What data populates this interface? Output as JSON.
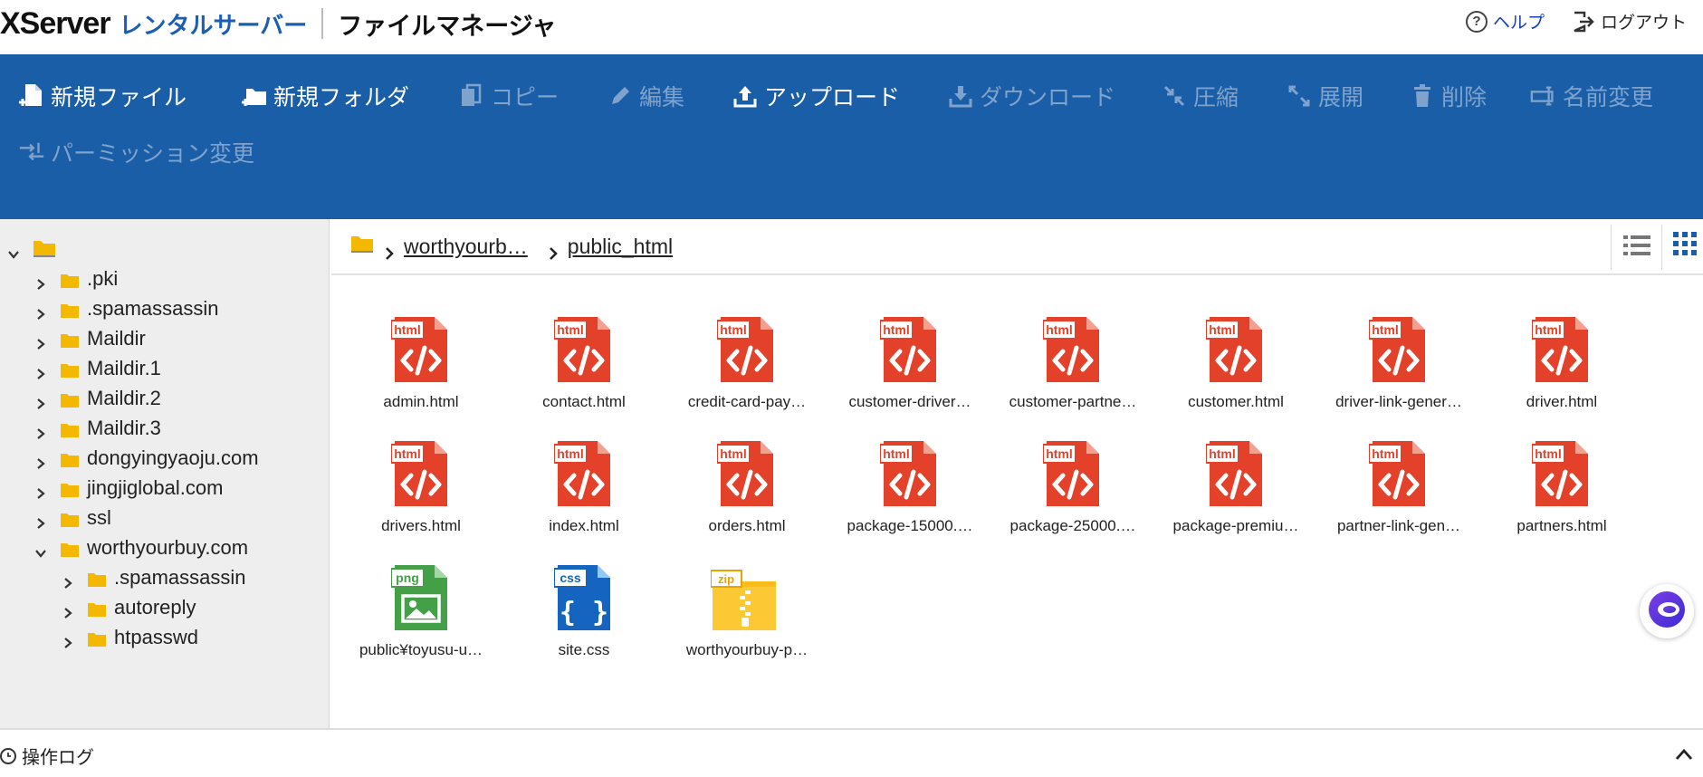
{
  "header": {
    "brand_x": "XServer",
    "brand_rental": "レンタルサーバー",
    "brand_fm": "ファイルマネージャ",
    "help_label": "ヘルプ",
    "help_glyph": "?",
    "logout_label": "ログアウト"
  },
  "toolbar": {
    "new_file": "新規ファイル",
    "new_folder": "新規フォルダ",
    "copy": "コピー",
    "edit": "編集",
    "upload": "アップロード",
    "download": "ダウンロード",
    "compress": "圧縮",
    "extract": "展開",
    "delete": "削除",
    "rename": "名前変更",
    "permission": "パーミッション変更"
  },
  "tree": [
    {
      "label": "",
      "level": 0,
      "expanded": true
    },
    {
      "label": ".pki",
      "level": 1,
      "expanded": false
    },
    {
      "label": ".spamassassin",
      "level": 1,
      "expanded": false
    },
    {
      "label": "Maildir",
      "level": 1,
      "expanded": false
    },
    {
      "label": "Maildir.1",
      "level": 1,
      "expanded": false
    },
    {
      "label": "Maildir.2",
      "level": 1,
      "expanded": false
    },
    {
      "label": "Maildir.3",
      "level": 1,
      "expanded": false
    },
    {
      "label": "dongyingyaoju.com",
      "level": 1,
      "expanded": false
    },
    {
      "label": "jingjiglobal.com",
      "level": 1,
      "expanded": false
    },
    {
      "label": "ssl",
      "level": 1,
      "expanded": false
    },
    {
      "label": "worthyourbuy.com",
      "level": 1,
      "expanded": true
    },
    {
      "label": ".spamassassin",
      "level": 2,
      "expanded": false
    },
    {
      "label": "autoreply",
      "level": 2,
      "expanded": false
    },
    {
      "label": "htpasswd",
      "level": 2,
      "expanded": false
    }
  ],
  "breadcrumb": {
    "items": [
      "worthyourb…",
      "public_html"
    ]
  },
  "files": [
    {
      "name": "admin.html",
      "type": "html"
    },
    {
      "name": "contact.html",
      "type": "html"
    },
    {
      "name": "credit-card-pay…",
      "type": "html"
    },
    {
      "name": "customer-driver…",
      "type": "html"
    },
    {
      "name": "customer-partne…",
      "type": "html"
    },
    {
      "name": "customer.html",
      "type": "html"
    },
    {
      "name": "driver-link-gener…",
      "type": "html"
    },
    {
      "name": "driver.html",
      "type": "html"
    },
    {
      "name": "drivers.html",
      "type": "html"
    },
    {
      "name": "index.html",
      "type": "html"
    },
    {
      "name": "orders.html",
      "type": "html"
    },
    {
      "name": "package-15000.…",
      "type": "html"
    },
    {
      "name": "package-25000.…",
      "type": "html"
    },
    {
      "name": "package-premiu…",
      "type": "html"
    },
    {
      "name": "partner-link-gen…",
      "type": "html"
    },
    {
      "name": "partners.html",
      "type": "html"
    },
    {
      "name": "public¥toyusu-u…",
      "type": "png"
    },
    {
      "name": "site.css",
      "type": "css"
    },
    {
      "name": "worthyourbuy-p…",
      "type": "zip"
    }
  ],
  "file_badges": {
    "html": "html",
    "png": "png",
    "css": "css",
    "zip": "zip"
  },
  "statusbar": {
    "oplog_label": "操作ログ"
  },
  "colors": {
    "toolbar_bg": "#1a5ea8",
    "brand_blue": "#1a5fb4",
    "html_red": "#e4412b",
    "png_green": "#43a047",
    "css_blue": "#1565c0",
    "zip_yellow": "#fbbc1c",
    "folder_yellow": "#f5b800",
    "disabled_text": "#7fa3cc"
  }
}
